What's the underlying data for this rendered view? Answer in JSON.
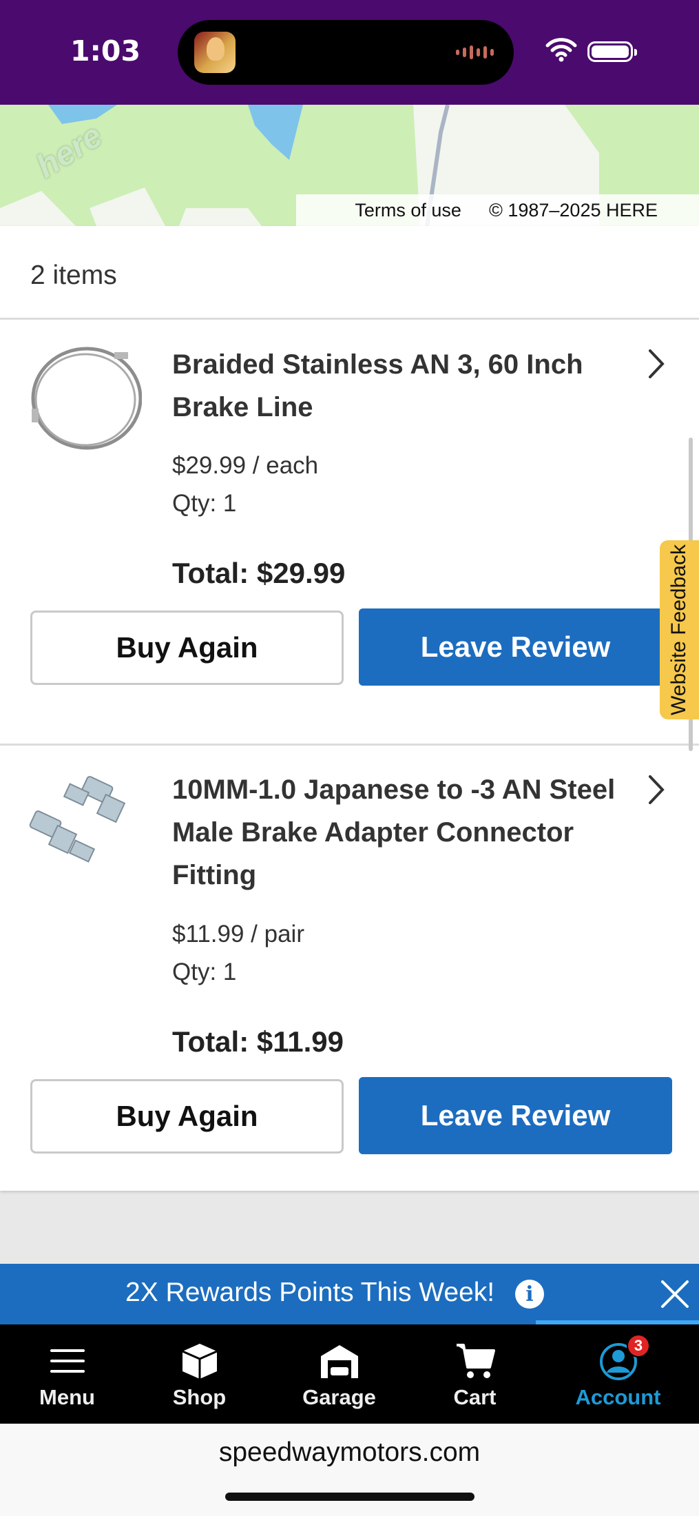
{
  "status_bar": {
    "time": "1:03"
  },
  "map": {
    "logo": "here",
    "terms_link": "Terms of use",
    "copyright": "© 1987–2025 HERE"
  },
  "order": {
    "items_count": "2 items",
    "items": [
      {
        "title_line1": "Braided Stainless AN 3, 60 Inch",
        "title_line2": "Brake Line",
        "price": "$29.99 / each",
        "qty": "Qty: 1",
        "total": "Total: $29.99",
        "buy_again": "Buy Again",
        "leave_review": "Leave Review"
      },
      {
        "title_line1": "10MM-1.0 Japanese to -3 AN Steel",
        "title_line2": "Male Brake Adapter Connector",
        "title_line3": "Fitting",
        "price": "$11.99 / pair",
        "qty": "Qty: 1",
        "total": "Total: $11.99",
        "buy_again": "Buy Again",
        "leave_review": "Leave Review"
      }
    ]
  },
  "feedback": {
    "label": "Website Feedback"
  },
  "rewards": {
    "text": "2X Rewards Points This Week!",
    "info_glyph": "i"
  },
  "nav": {
    "items": [
      {
        "label": "Menu",
        "icon": "menu-icon"
      },
      {
        "label": "Shop",
        "icon": "box-icon"
      },
      {
        "label": "Garage",
        "icon": "garage-icon"
      },
      {
        "label": "Cart",
        "icon": "cart-icon"
      },
      {
        "label": "Account",
        "icon": "account-icon",
        "badge": "3",
        "active": true
      }
    ]
  },
  "browser": {
    "url": "speedwaymotors.com"
  },
  "colors": {
    "brand_blue": "#1c6dbf",
    "status_purple": "#4b0a6e",
    "feedback_yellow": "#f6c84b",
    "active_nav": "#1e9ad6"
  }
}
